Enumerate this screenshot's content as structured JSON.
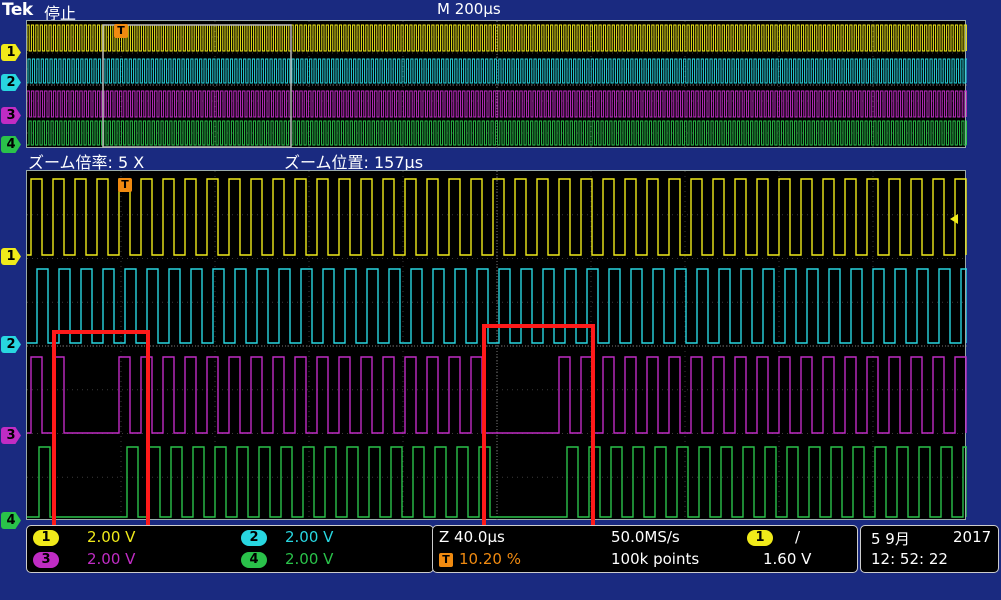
{
  "header": {
    "brand": "Tek",
    "run_state": "停止",
    "timebase": "M 200µs"
  },
  "zoom": {
    "factor_label": "ズーム倍率: 5 X",
    "position_label": "ズーム位置: 157µs"
  },
  "markers": [
    "1",
    "2",
    "3",
    "4"
  ],
  "trigger_marker": "T",
  "channels": [
    {
      "id": "1",
      "volts": "2.00 V",
      "color": "#f0ea1a"
    },
    {
      "id": "2",
      "volts": "2.00 V",
      "color": "#28d6e0"
    },
    {
      "id": "3",
      "volts": "2.00 V",
      "color": "#c02cc4"
    },
    {
      "id": "4",
      "volts": "2.00 V",
      "color": "#2ac24a"
    }
  ],
  "acquisition": {
    "zoom_scale": "Z 40.0µs",
    "trigger_pos": "10.20 %",
    "sample_rate": "50.0MS/s",
    "record_length": "100k points",
    "trigger_channel": "1",
    "trigger_slope": "/",
    "trigger_level": "1.60 V"
  },
  "clock": {
    "date": "5 9月",
    "year": "2017",
    "time": "12: 52: 22"
  },
  "colors": {
    "background": "#1a2a80",
    "highlight": "#ff1a1a",
    "trigger": "#f08a10"
  }
}
